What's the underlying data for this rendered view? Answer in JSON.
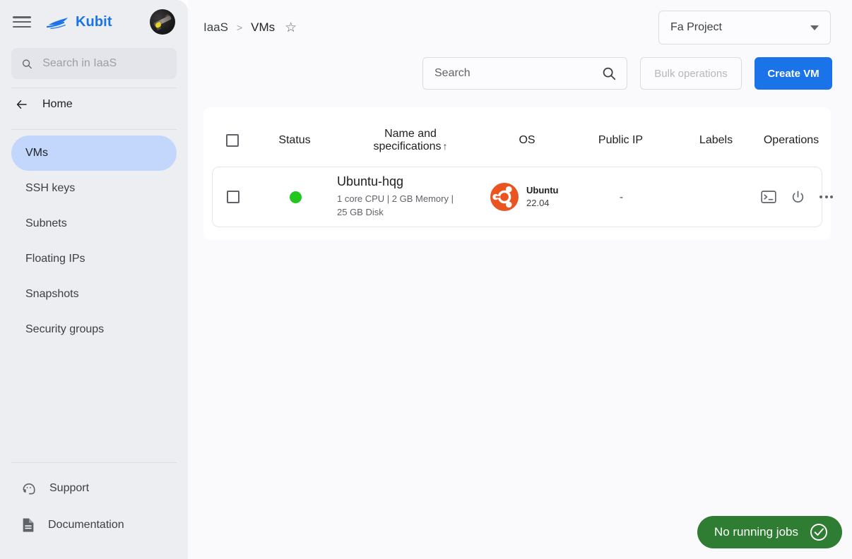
{
  "sidebar": {
    "menu_icon": "hamburger-icon",
    "brand": "Kubit",
    "avatar_icon": "user-avatar",
    "search": {
      "value": "",
      "placeholder": "Search in IaaS",
      "icon": "search-icon"
    },
    "home": {
      "label": "Home",
      "icon": "back-arrow-icon"
    },
    "items": [
      {
        "label": "VMs",
        "active": true
      },
      {
        "label": "SSH keys",
        "active": false
      },
      {
        "label": "Subnets",
        "active": false
      },
      {
        "label": "Floating IPs",
        "active": false
      },
      {
        "label": "Snapshots",
        "active": false
      },
      {
        "label": "Security groups",
        "active": false
      }
    ],
    "footer": [
      {
        "label": "Support",
        "icon": "support-headset-icon"
      },
      {
        "label": "Documentation",
        "icon": "document-icon"
      }
    ],
    "active_color": "#c2d7fb",
    "brand_color": "#1a73e8"
  },
  "header": {
    "breadcrumb": {
      "root": "IaaS",
      "separator": ">",
      "current": "VMs",
      "favorite_icon": "star-outline-icon"
    },
    "project_selector": {
      "value": "Fa Project",
      "icon": "chevron-down-icon"
    }
  },
  "toolbar": {
    "search": {
      "value": "",
      "placeholder": "Search",
      "icon": "search-icon"
    },
    "bulk_operations_label": "Bulk operations",
    "create_vm_label": "Create VM",
    "primary_color": "#1a73e8"
  },
  "table": {
    "select_all_icon": "checkbox-unchecked",
    "columns": [
      {
        "label": "Status"
      },
      {
        "label": "Name and",
        "label2": "specifications",
        "sort_icon": "↑"
      },
      {
        "label": "OS"
      },
      {
        "label": "Public IP"
      },
      {
        "label": "Labels"
      },
      {
        "label": "Operations"
      }
    ],
    "rows": [
      {
        "checkbox_icon": "checkbox-unchecked",
        "status": "running",
        "status_color": "#1fc71f",
        "name": "Ubuntu-hqg",
        "specs": "1 core CPU | 2 GB Memory | 25 GB Disk",
        "os_name": "Ubuntu",
        "os_version": "22.04",
        "os_icon": "ubuntu-logo",
        "os_color": "#e95420",
        "public_ip": "-",
        "labels": "",
        "operations": [
          {
            "icon": "console-terminal-icon"
          },
          {
            "icon": "power-icon"
          },
          {
            "icon": "more-options-icon"
          }
        ]
      }
    ]
  },
  "toast": {
    "label": "No running jobs",
    "icon": "check-circle-icon",
    "color": "#2e7d32"
  }
}
